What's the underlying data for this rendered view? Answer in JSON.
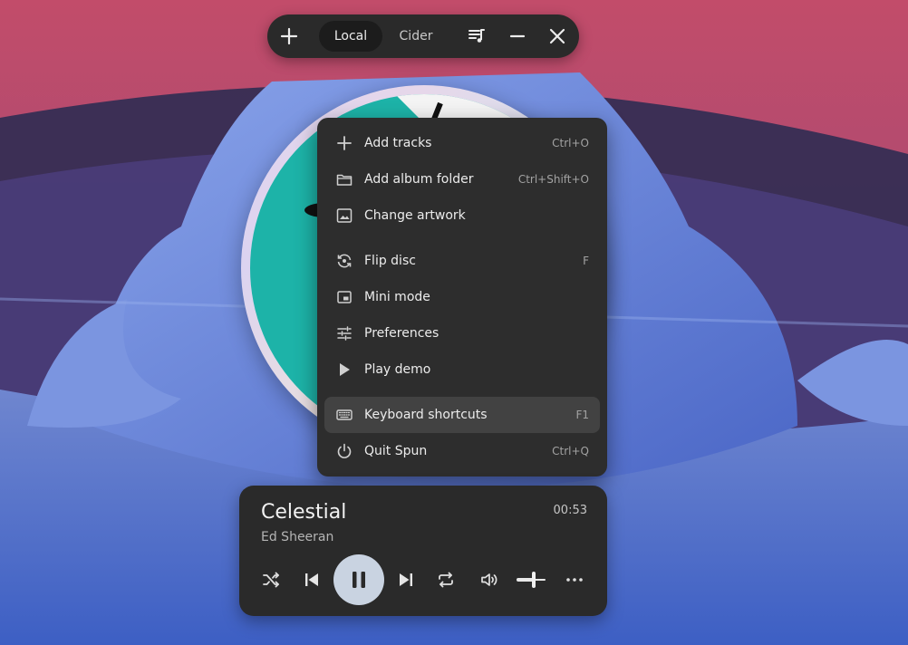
{
  "header": {
    "add_icon": "plus-icon",
    "tabs": [
      {
        "label": "Local",
        "active": true
      },
      {
        "label": "Cider",
        "active": false
      }
    ],
    "queue_icon": "playlist-icon",
    "minimize_icon": "minimize-icon",
    "close_icon": "close-icon"
  },
  "menu": {
    "items": [
      {
        "label": "Add tracks",
        "accelerator": "Ctrl+O",
        "icon": "plus-icon"
      },
      {
        "label": "Add album folder",
        "accelerator": "Ctrl+Shift+O",
        "icon": "folder-icon"
      },
      {
        "label": "Change artwork",
        "accelerator": "",
        "icon": "image-icon"
      },
      {
        "label": "Flip disc",
        "accelerator": "F",
        "icon": "flip-icon"
      },
      {
        "label": "Mini mode",
        "accelerator": "",
        "icon": "mini-mode-icon"
      },
      {
        "label": "Preferences",
        "accelerator": "",
        "icon": "sliders-icon"
      },
      {
        "label": "Play demo",
        "accelerator": "",
        "icon": "play-icon"
      },
      {
        "label": "Keyboard shortcuts",
        "accelerator": "F1",
        "icon": "keyboard-icon",
        "highlighted": true
      },
      {
        "label": "Quit Spun",
        "accelerator": "Ctrl+Q",
        "icon": "power-icon"
      }
    ]
  },
  "player": {
    "title": "Celestial",
    "artist": "Ed Sheeran",
    "elapsed": "00:53",
    "state": "playing",
    "volume": 0.6
  },
  "colors": {
    "panel": "#2a2a2a",
    "menu_bg": "#2d2d2d",
    "menu_highlight": "#424242",
    "play_button": "#c9d3e1",
    "disc_art": "#1db3a8"
  }
}
